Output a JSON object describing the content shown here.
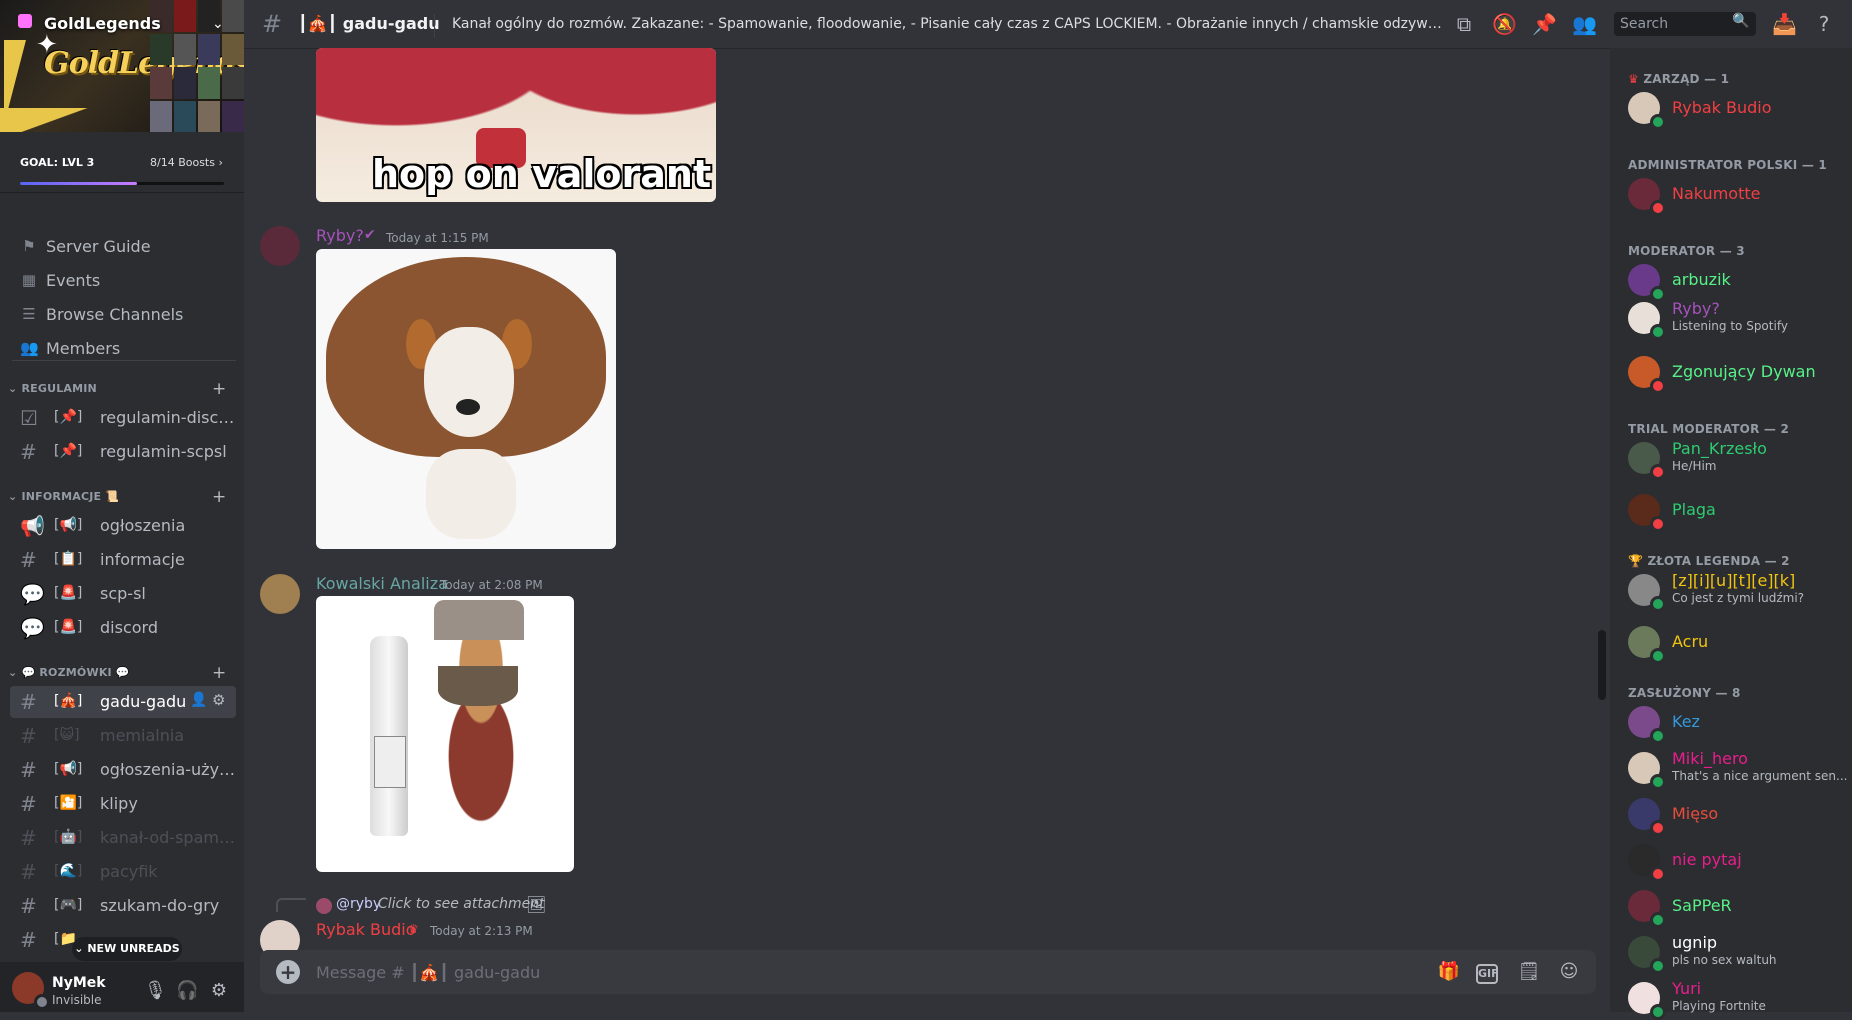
{
  "server": {
    "name": "GoldLegends",
    "banner_text": "GoldLegends",
    "goal_label": "GOAL: LVL 3",
    "goal_boosts": "8/14 Boosts",
    "goal_progress": 0.5714
  },
  "nav": {
    "items": [
      {
        "label": "Server Guide",
        "icon": "signpost-icon"
      },
      {
        "label": "Events",
        "icon": "calendar-icon"
      },
      {
        "label": "Browse Channels",
        "icon": "browse-channels-icon"
      },
      {
        "label": "Members",
        "icon": "members-icon"
      }
    ]
  },
  "categories": [
    {
      "name": "REGULAMIN"
    },
    {
      "name": "INFORMACJE"
    },
    {
      "name": "ROZMÓWKI"
    }
  ],
  "channels": {
    "regulamin": [
      {
        "label": "regulamin-disco...",
        "emoji": "📌"
      },
      {
        "label": "regulamin-scpsl",
        "emoji": "📌"
      }
    ],
    "informacje": [
      {
        "label": "ogłoszenia",
        "emoji": "📢"
      },
      {
        "label": "informacje",
        "emoji": "📋"
      },
      {
        "label": "scp-sl",
        "emoji": "🚨"
      },
      {
        "label": "discord",
        "emoji": "🚨"
      }
    ],
    "rozmowki": [
      {
        "label": "gadu-gadu",
        "emoji": "🎪"
      },
      {
        "label": "memialnia",
        "emoji": "😺"
      },
      {
        "label": "ogłoszenia-użytk...",
        "emoji": "📢"
      },
      {
        "label": "klipy",
        "emoji": "🎦"
      },
      {
        "label": "kanał-od-spamu...",
        "emoji": "🤖"
      },
      {
        "label": "pacyfik",
        "emoji": "🌊"
      },
      {
        "label": "szukam-do-gry",
        "emoji": "🎮"
      },
      {
        "label": "",
        "emoji": "📁"
      }
    ]
  },
  "new_unreads": "NEW UNREADS",
  "user": {
    "name": "NyMek",
    "status": "Invisible"
  },
  "header": {
    "channel": "gadu-gadu",
    "channel_emoji": "🎪",
    "topic": "Kanał ogólny do rozmów. Zakazane: - Spamowanie, floodowanie, - Pisanie cały czas z CAPS LOCKIEM. - Obrażanie innych / chamskie odzywki. - Wszelkie wiadomoś...",
    "search_placeholder": "Search"
  },
  "messages": [
    {
      "image_caption": "hop on valorant"
    },
    {
      "author": "Ryby?",
      "time": "Today at 1:15 PM",
      "color": "#a652bb"
    },
    {
      "author": "Kowalski Analiza",
      "time": "Today at 2:08 PM",
      "color": "#68a6a3"
    },
    {
      "reply_mention": "@ryby",
      "reply_text": "Click to see attachment",
      "author": "Rybak Budio",
      "time": "Today at 2:13 PM",
      "color": "#f23f43"
    }
  ],
  "composer": {
    "placeholder": "Message # ┃🎪┃ gadu-gadu"
  },
  "members": {
    "groups": [
      {
        "role": "ZARZĄD — 1",
        "members": [
          {
            "name": "Rybak Budio",
            "color": "#f23f43",
            "sub": "",
            "status": "#23a55a"
          }
        ]
      },
      {
        "role": "ADMINISTRATOR POLSKI — 1",
        "members": [
          {
            "name": "Nakumotte",
            "color": "#f23f43",
            "sub": "",
            "status": "#f23f43"
          }
        ]
      },
      {
        "role": "MODERATOR — 3",
        "members": [
          {
            "name": "arbuzik",
            "color": "#57f287",
            "sub": "",
            "status": "#23a55a"
          },
          {
            "name": "Ryby?",
            "color": "#a652bb",
            "sub": "Listening to Spotify",
            "status": "#23a55a"
          },
          {
            "name": "Zgonujący Dywan",
            "color": "#57f287",
            "sub": "",
            "status": "#f23f43"
          }
        ]
      },
      {
        "role": "TRIAL MODERATOR — 2",
        "members": [
          {
            "name": "Pan_Krzesło",
            "color": "#2ecc71",
            "sub": "He/Him",
            "status": "#f23f43"
          },
          {
            "name": "Plaga",
            "color": "#2ecc71",
            "sub": "",
            "status": "#f23f43"
          }
        ]
      },
      {
        "role": "ZŁOTA LEGENDA — 2",
        "members": [
          {
            "name": "[z][i][u][t][e][k]",
            "color": "#f1c40f",
            "sub": "Co jest z tymi ludźmi?",
            "status": "#23a55a"
          },
          {
            "name": "Acru",
            "color": "#f1c40f",
            "sub": "",
            "status": "#23a55a"
          }
        ]
      },
      {
        "role": "ZASŁUŻONY — 8",
        "members": [
          {
            "name": "Kez",
            "color": "#3498db",
            "sub": "",
            "status": "#23a55a"
          },
          {
            "name": "Miki_hero",
            "color": "#e91e8c",
            "sub": "That's a nice argument sen...",
            "status": "#23a55a"
          },
          {
            "name": "Mięso",
            "color": "#e74c3c",
            "sub": "",
            "status": "#f23f43"
          },
          {
            "name": "nie pytaj",
            "color": "#e91e8c",
            "sub": "",
            "status": "#f23f43"
          },
          {
            "name": "SaPPeR",
            "color": "#57f287",
            "sub": "",
            "status": "#23a55a"
          },
          {
            "name": "ugnip",
            "color": "#ffffff",
            "sub": "pls no sex waltuh",
            "status": "#23a55a"
          },
          {
            "name": "Yuri",
            "color": "#e91e8c",
            "sub": "Playing Fortnite",
            "status": "#23a55a"
          }
        ]
      }
    ]
  }
}
